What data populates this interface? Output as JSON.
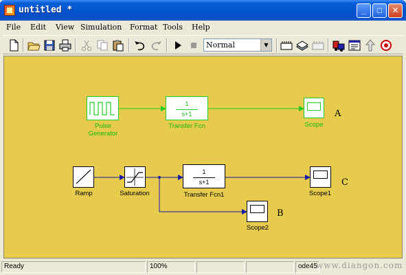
{
  "window": {
    "title": "untitled *"
  },
  "menu": {
    "items": [
      "File",
      "Edit",
      "View",
      "Simulation",
      "Format",
      "Tools",
      "Help"
    ]
  },
  "toolbar": {
    "sim_mode": "Normal"
  },
  "diagram": {
    "blocks": {
      "pulse_generator": "Pulse\nGenerator",
      "transfer_fcn": "Transfer Fcn",
      "scope": "Scope",
      "ramp": "Ramp",
      "saturation": "Saturation",
      "transfer_fcn1": "Transfer Fcn1",
      "scope1": "Scope1",
      "scope2": "Scope2"
    },
    "tf_numerator": "1",
    "tf_denominator": "s+1",
    "annotations": {
      "a": "A",
      "b": "B",
      "c": "C"
    },
    "colors": {
      "canvas": "#e6cb4c",
      "green_line": "#22cc22",
      "blue_line": "#1a1aa8"
    }
  },
  "status": {
    "state": "Ready",
    "zoom": "100%",
    "solver": "ode45",
    "watermark": "www.diangon.com"
  }
}
